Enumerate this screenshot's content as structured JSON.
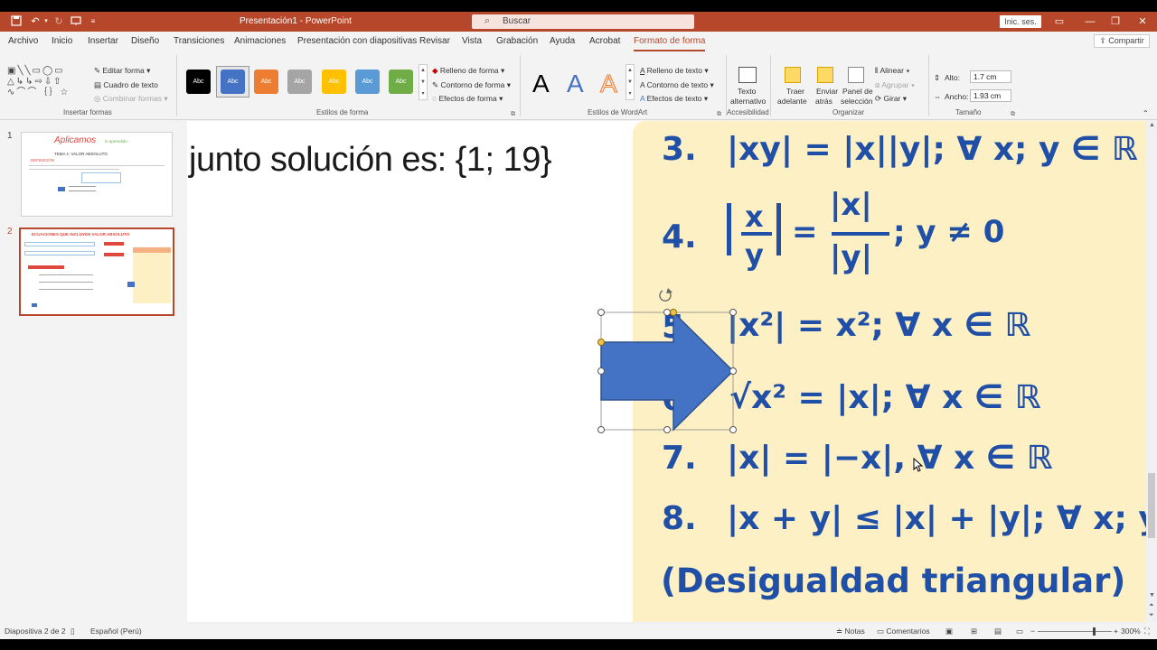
{
  "window": {
    "doc_title": "Presentación1 - PowerPoint",
    "search_label": "Buscar",
    "signin_label": "Inic. ses.",
    "qat_icons": [
      "save-icon",
      "undo-icon",
      "redo-icon",
      "present-icon",
      "customize-icon"
    ]
  },
  "tabs": [
    "Archivo",
    "Inicio",
    "Insertar",
    "Diseño",
    "Transiciones",
    "Animaciones",
    "Presentación con diapositivas",
    "Revisar",
    "Vista",
    "Grabación",
    "Ayuda",
    "Acrobat",
    "Formato de forma"
  ],
  "active_tab": "Formato de forma",
  "share_label": "Compartir",
  "ribbon": {
    "insert_shapes": {
      "label": "Insertar formas",
      "edit_shape": "Editar forma",
      "text_box": "Cuadro de texto",
      "merge_shapes": "Combinar formas"
    },
    "shape_styles": {
      "label": "Estilos de forma",
      "style_label": "Abc",
      "style_colors": [
        "#000000",
        "#4472c4",
        "#ed7d31",
        "#a5a5a5",
        "#ffc000",
        "#5b9bd5",
        "#70ad47"
      ],
      "fill": "Relleno de forma",
      "outline": "Contorno de forma",
      "effects": "Efectos de forma"
    },
    "wordart": {
      "label": "Estilos de WordArt",
      "letter": "A",
      "text_fill": "Relleno de texto",
      "text_outline": "Contorno de texto",
      "text_effects": "Efectos de texto"
    },
    "accessibility": {
      "label": "Accesibilidad",
      "alt_text_1": "Texto",
      "alt_text_2": "alternativo"
    },
    "arrange": {
      "label": "Organizar",
      "bring_forward_1": "Traer",
      "bring_forward_2": "adelante",
      "send_backward_1": "Enviar",
      "send_backward_2": "atrás",
      "selection_pane_1": "Panel de",
      "selection_pane_2": "selección",
      "align": "Alinear",
      "group": "Agrupar",
      "rotate": "Girar"
    },
    "size": {
      "label": "Tamaño",
      "height_label": "Alto:",
      "height_value": "1.7 cm",
      "width_label": "Ancho:",
      "width_value": "1.93 cm"
    }
  },
  "thumbnails": [
    {
      "num": "1",
      "title": "Aplicamos",
      "subtitle": "lo aprendido",
      "heading": "TEMA 1:   VALOR ABSOLUTO",
      "def": "DEFINICIÓN"
    },
    {
      "num": "2",
      "title": "ECUACIONES QUE INCLUYEN VALOR ABSOLUTO"
    }
  ],
  "slide": {
    "left_text": "junto solución es:  {1; 19}",
    "equations": [
      {
        "num": "3.",
        "text": "|xy| = |x||y|; ∀ x; y ∈ ℝ"
      },
      {
        "num": "4.",
        "text": "; y ≠ 0"
      },
      {
        "num": "5.",
        "text": "|x²| = x²; ∀ x ∈ ℝ"
      },
      {
        "num": "6.",
        "text": "√x²  = |x|; ∀ x ∈ ℝ"
      },
      {
        "num": "7.",
        "text": "|x| = |−x|, ∀ x ∈ ℝ"
      },
      {
        "num": "8.",
        "text": "|x + y| ≤ |x| + |y|; ∀ x; y ∈ ℝ"
      }
    ],
    "frac_x": "x",
    "frac_y": "y",
    "frac_abs_x": "|x|",
    "frac_abs_y": "|y|",
    "triangle_text": "(Desigualdad triangular)",
    "arrow_color": "#4472c4"
  },
  "status": {
    "slide_info": "Diapositiva 2 de 2",
    "language": "Español (Perú)",
    "notes": "Notas",
    "comments": "Comentarios",
    "zoom": "300%"
  }
}
